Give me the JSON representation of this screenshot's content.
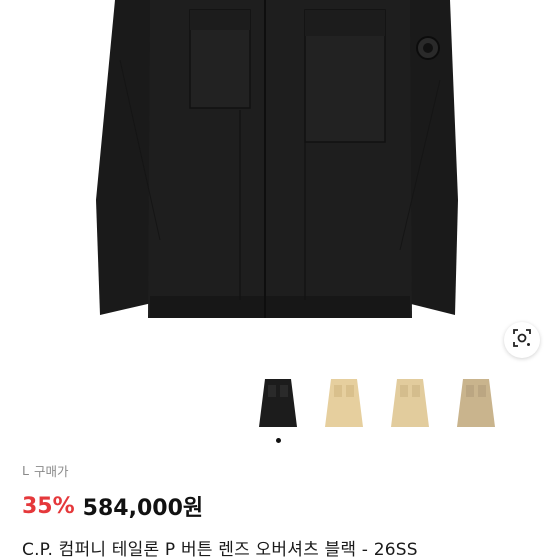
{
  "product": {
    "size_label": "L",
    "buy_label": "구매가",
    "discount": "35%",
    "price": "584,000원",
    "title": "C.P. 컴퍼니 테일론 P 버튼 렌즈 오버셔츠 블랙 - 26SS"
  },
  "gallery": {
    "thumbnails": [
      {
        "color": "#1c1c1c",
        "name": "black"
      },
      {
        "color": "#e6cf9e",
        "name": "beige-1"
      },
      {
        "color": "#e2cc9d",
        "name": "beige-2"
      },
      {
        "color": "#c9b48d",
        "name": "beige-3"
      }
    ],
    "active_index": 0
  },
  "icons": {
    "lens_search": "lens-search-icon"
  },
  "colors": {
    "discount": "#e5383b",
    "jacket": "#1b1b1b"
  }
}
